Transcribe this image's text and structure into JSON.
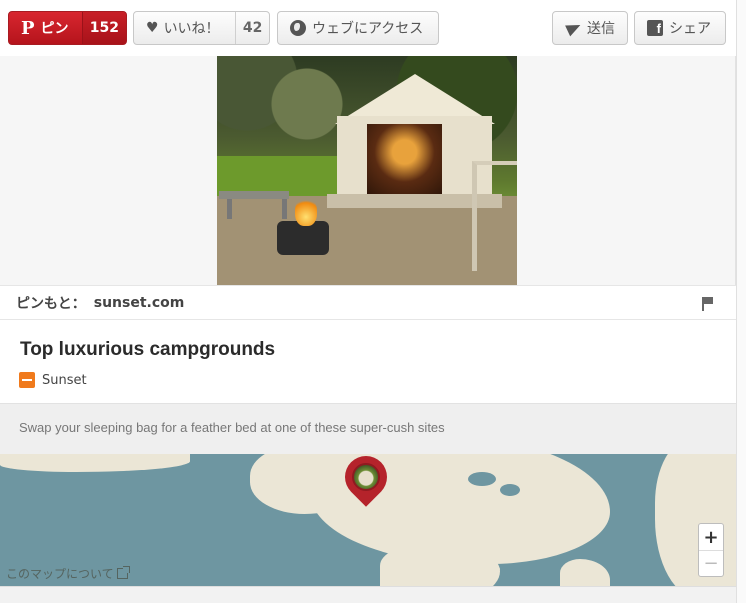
{
  "toolbar": {
    "pin_label": "ピン",
    "pin_count": "152",
    "like_label": "いいね！",
    "like_count": "42",
    "web_label": "ウェブにアクセス",
    "send_label": "送信",
    "share_label": "シェア"
  },
  "source": {
    "label": "ピンもと：",
    "domain": "sunset.com"
  },
  "pin": {
    "title": "Top luxurious campgrounds",
    "provider": "Sunset",
    "description": "Swap your sleeping bag for a feather bed at one of these super-cush sites"
  },
  "map": {
    "about_label": "このマップについて",
    "zoom_in": "+",
    "zoom_out": "−"
  },
  "colors": {
    "pin_red": "#cc1f27",
    "provider_orange": "#f07a1c",
    "map_water": "#6e96a1",
    "map_land": "#ebe6d6"
  }
}
